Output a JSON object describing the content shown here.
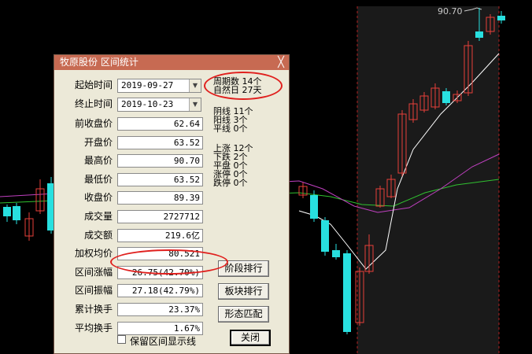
{
  "chart": {
    "top_price_label": "90.70",
    "colors": {
      "up": "#e8403a",
      "down": "#28e0e0",
      "ma_white": "#ffffff",
      "ma_purple": "#c040c0",
      "ma_green": "#30c030",
      "grid": "#b02020"
    }
  },
  "dialog": {
    "title": "牧原股份 区间统计",
    "close_glyph": "╳",
    "start_label": "起始时间",
    "start_value": "2019-09-27",
    "end_label": "终止时间",
    "end_value": "2019-10-23",
    "rows": [
      {
        "label": "前收盘价",
        "value": "62.64"
      },
      {
        "label": "开盘价",
        "value": "63.52"
      },
      {
        "label": "最高价",
        "value": "90.70"
      },
      {
        "label": "最低价",
        "value": "63.52"
      },
      {
        "label": "收盘价",
        "value": "89.39"
      },
      {
        "label": "成交量",
        "value": "2727712"
      },
      {
        "label": "成交额",
        "value": "219.6亿"
      },
      {
        "label": "加权均价",
        "value": "80.521"
      },
      {
        "label": "区间涨幅",
        "value": "26.75(42.70%)"
      },
      {
        "label": "区间振幅",
        "value": "27.18(42.79%)"
      },
      {
        "label": "累计换手",
        "value": "23.37%"
      },
      {
        "label": "平均换手",
        "value": "1.67%"
      }
    ],
    "stats": [
      "周期数 14个",
      "自然日 27天",
      "阴线 11个",
      "阳线 3个",
      "平线 0个",
      "上涨 12个",
      "下跌 2个",
      "平盘 0个",
      "涨停 0个",
      "跌停 0个"
    ],
    "buttons": {
      "stage": "阶段排行",
      "sector": "板块排行",
      "pattern": "形态匹配",
      "close": "关闭"
    },
    "checkbox_label": "保留区间显示线"
  }
}
